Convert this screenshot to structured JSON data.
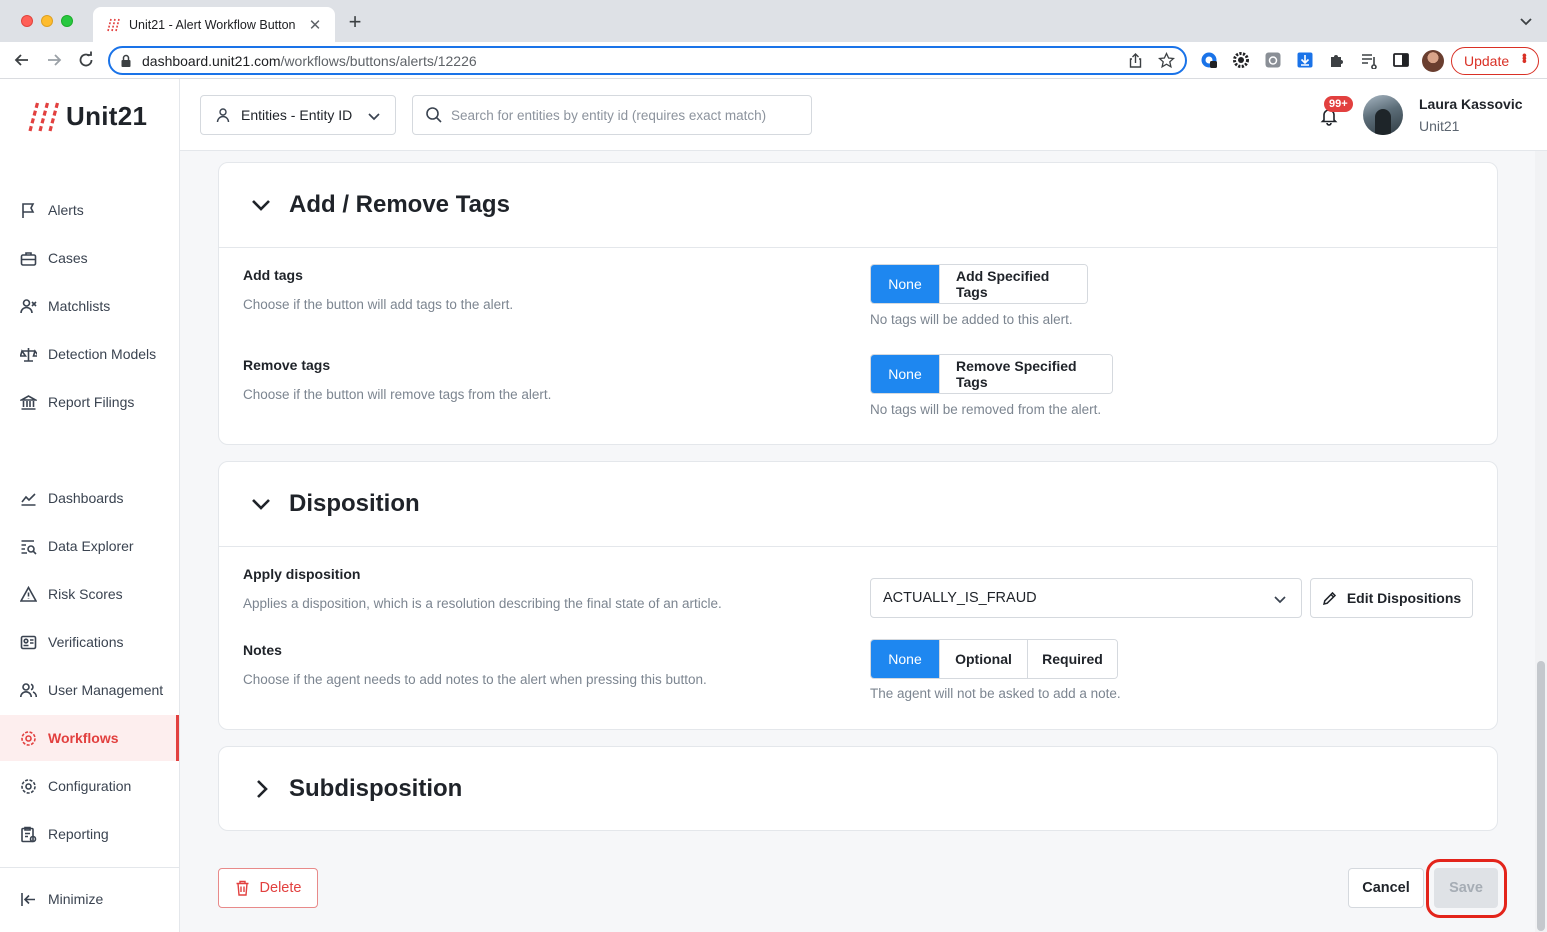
{
  "browser": {
    "tab_title": "Unit21 - Alert Workflow Button",
    "url_host": "dashboard.unit21.com",
    "url_path": "/workflows/buttons/alerts/12226",
    "update_label": "Update"
  },
  "brand": {
    "name": "Unit21",
    "accent": "#e2403f"
  },
  "sidebar": {
    "items": [
      {
        "label": "Alerts",
        "icon": "flag-icon"
      },
      {
        "label": "Cases",
        "icon": "briefcase-icon"
      },
      {
        "label": "Matchlists",
        "icon": "user-x-icon"
      },
      {
        "label": "Detection Models",
        "icon": "scale-icon"
      },
      {
        "label": "Report Filings",
        "icon": "bank-icon"
      },
      {
        "label": "Dashboards",
        "icon": "trend-icon"
      },
      {
        "label": "Data Explorer",
        "icon": "list-search-icon"
      },
      {
        "label": "Risk Scores",
        "icon": "warning-icon"
      },
      {
        "label": "Verifications",
        "icon": "id-card-icon"
      },
      {
        "label": "User Management",
        "icon": "users-icon"
      },
      {
        "label": "Workflows",
        "icon": "workflow-icon",
        "active": true
      },
      {
        "label": "Configuration",
        "icon": "gear-icon"
      },
      {
        "label": "Reporting",
        "icon": "report-icon"
      }
    ],
    "minimize_label": "Minimize"
  },
  "header": {
    "entity_select": "Entities - Entity ID",
    "search_placeholder": "Search for entities by entity id (requires exact match)",
    "notification_count": "99+",
    "user_name": "Laura Kassovic",
    "user_org": "Unit21"
  },
  "sections": {
    "tags": {
      "title": "Add / Remove Tags",
      "add": {
        "title": "Add tags",
        "desc": "Choose if the button will add tags to the alert.",
        "options": [
          "None",
          "Add Specified Tags"
        ],
        "helper": "No tags will be added to this alert."
      },
      "remove": {
        "title": "Remove tags",
        "desc": "Choose if the button will remove tags from the alert.",
        "options": [
          "None",
          "Remove Specified Tags"
        ],
        "helper": "No tags will be removed from the alert."
      }
    },
    "disposition": {
      "title": "Disposition",
      "apply": {
        "title": "Apply disposition",
        "desc": "Applies a disposition, which is a resolution describing the final state of an article.",
        "value": "ACTUALLY_IS_FRAUD",
        "edit_label": "Edit Dispositions"
      },
      "notes": {
        "title": "Notes",
        "desc": "Choose if the agent needs to add notes to the alert when pressing this button.",
        "options": [
          "None",
          "Optional",
          "Required"
        ],
        "helper": "The agent will not be asked to add a note."
      }
    },
    "subdisposition": {
      "title": "Subdisposition"
    }
  },
  "footer": {
    "delete_label": "Delete",
    "cancel_label": "Cancel",
    "save_label": "Save"
  }
}
